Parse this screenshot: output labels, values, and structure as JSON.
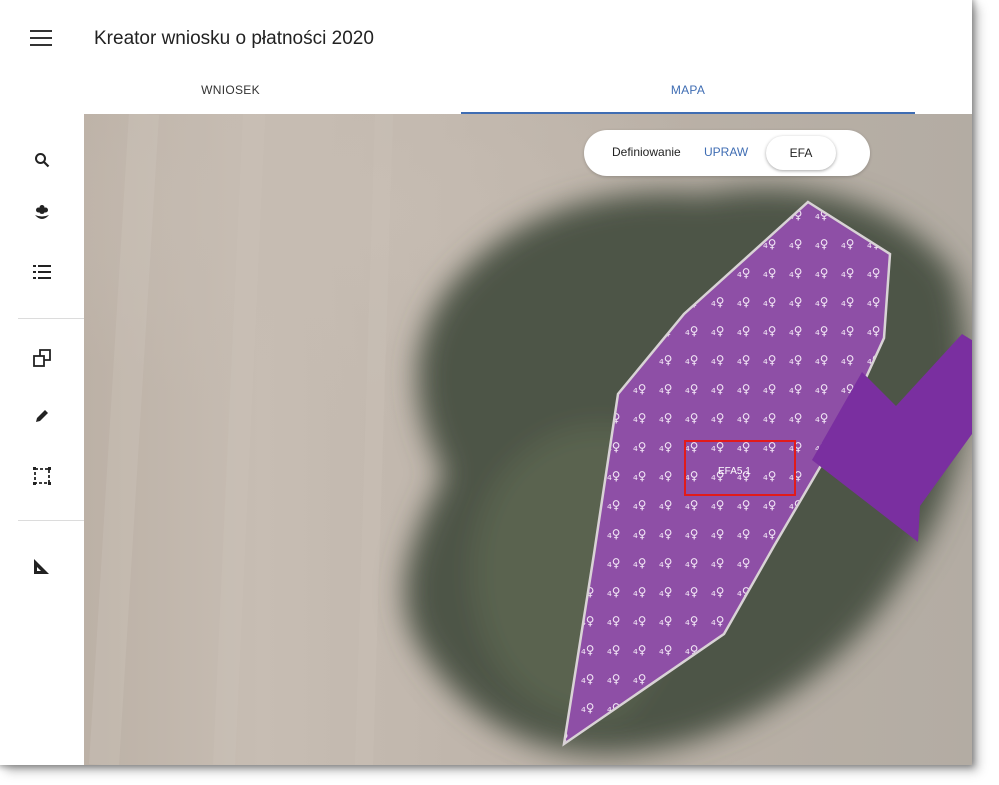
{
  "app": {
    "title": "Kreator wniosku o płatności 2020",
    "menu_icon": "hamburger-menu-icon"
  },
  "tabs": [
    {
      "label": "WNIOSEK",
      "active": false
    },
    {
      "label": "MAPA",
      "active": true
    }
  ],
  "sidebar": {
    "items": [
      {
        "name": "search",
        "icon": "search-icon"
      },
      {
        "name": "crops",
        "icon": "flower-pin-icon"
      },
      {
        "name": "list",
        "icon": "list-icon"
      },
      {
        "name": "copy",
        "icon": "copy-shapes-icon"
      },
      {
        "name": "edit",
        "icon": "pencil-icon"
      },
      {
        "name": "select-area",
        "icon": "selection-rectangle-icon"
      },
      {
        "name": "measure",
        "icon": "ruler-triangle-icon"
      }
    ]
  },
  "map": {
    "mode_toggle": {
      "label": "Definiowanie",
      "option_upraw": "UPRAW",
      "option_efa": "EFA",
      "selected": "EFA"
    },
    "parcel": {
      "label": "EFA5.1",
      "fill_color": "#8e4fa6",
      "pattern_glyph": "₄♀"
    },
    "highlight_color": "#e21b1b",
    "arrow_color": "#7a2fa0"
  }
}
